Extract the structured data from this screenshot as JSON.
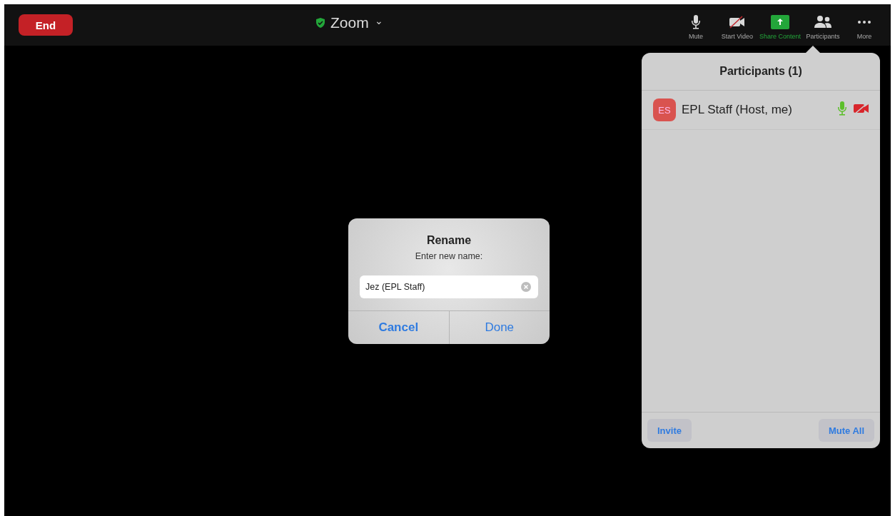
{
  "toolbar": {
    "end_button": "End",
    "meeting_title": "Zoom",
    "title_caret": "⌄",
    "actions": [
      {
        "kind": "mic",
        "label": "Mute"
      },
      {
        "kind": "video",
        "label": "Start Video"
      },
      {
        "kind": "share",
        "label": "Share Content"
      },
      {
        "kind": "people",
        "label": "Participants"
      },
      {
        "kind": "more",
        "label": "More"
      }
    ]
  },
  "participants_panel": {
    "title": "Participants (1)",
    "participants": [
      {
        "initials": "ES",
        "name": "EPL Staff (Host, me)",
        "mic_on": true,
        "video_on": false
      }
    ],
    "buttons": [
      "Invite",
      "Mute All"
    ]
  },
  "rename_dialog": {
    "title": "Rename",
    "message": "Enter new name:",
    "value": "Jez (EPL Staff)",
    "buttons": [
      "Cancel",
      "Done"
    ]
  }
}
